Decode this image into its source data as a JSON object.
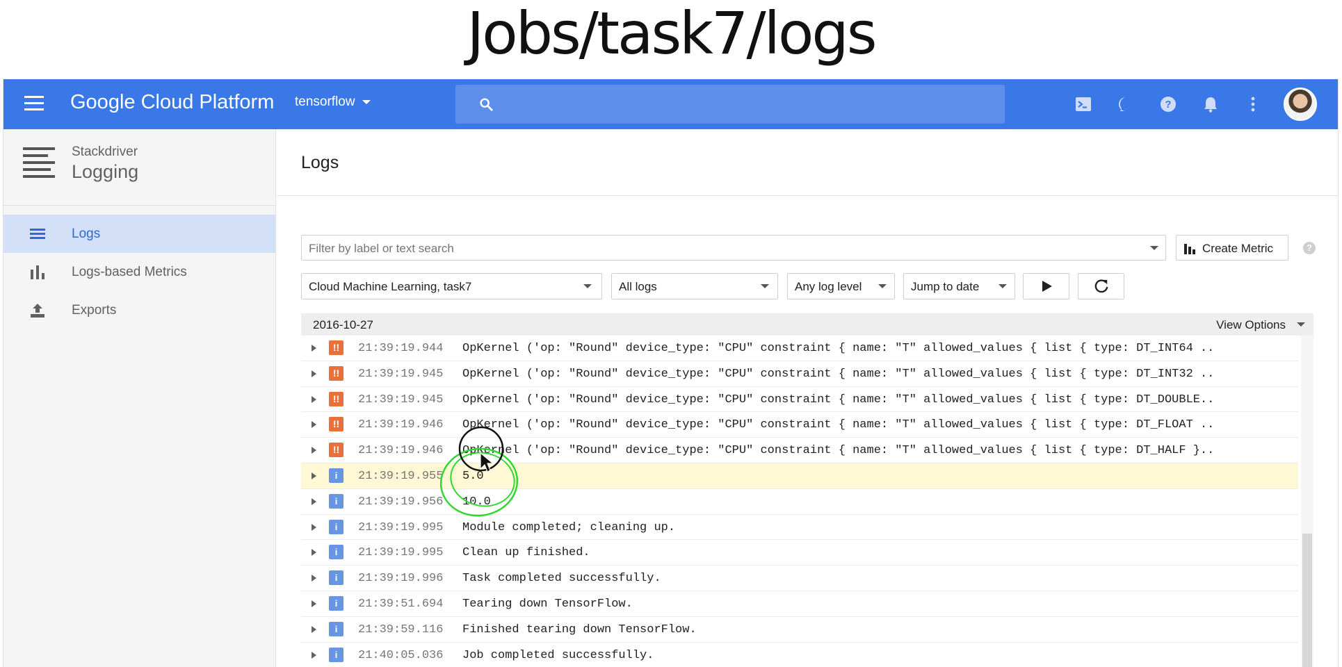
{
  "slide": {
    "title": "Jobs/task7/logs"
  },
  "topbar": {
    "brand": "Google Cloud Platform",
    "project": "tensorflow",
    "icons": [
      "cloud-shell-icon",
      "feedback-icon",
      "help-icon",
      "notifications-icon",
      "more-vert-icon",
      "avatar"
    ]
  },
  "sidebar": {
    "product_sub": "Stackdriver",
    "product_name": "Logging",
    "items": [
      {
        "label": "Logs",
        "icon": "logs-list-icon",
        "active": true
      },
      {
        "label": "Logs-based Metrics",
        "icon": "bar-chart-icon",
        "active": false
      },
      {
        "label": "Exports",
        "icon": "export-icon",
        "active": false
      }
    ]
  },
  "main": {
    "title": "Logs",
    "filter_placeholder": "Filter by label or text search",
    "create_metric": "Create Metric",
    "help": "?",
    "resource": "Cloud Machine Learning, task7",
    "log_name": "All logs",
    "log_level": "Any log level",
    "jump": "Jump to date",
    "date": "2016-10-27",
    "view_options": "View Options"
  },
  "logs": [
    {
      "severity": "error",
      "time": "21:39:19.944",
      "message": "OpKernel ('op: \"Round\" device_type: \"CPU\" constraint { name: \"T\" allowed_values { list { type: DT_INT64 .."
    },
    {
      "severity": "error",
      "time": "21:39:19.945",
      "message": "OpKernel ('op: \"Round\" device_type: \"CPU\" constraint { name: \"T\" allowed_values { list { type: DT_INT32 .."
    },
    {
      "severity": "error",
      "time": "21:39:19.945",
      "message": "OpKernel ('op: \"Round\" device_type: \"CPU\" constraint { name: \"T\" allowed_values { list { type: DT_DOUBLE.."
    },
    {
      "severity": "error",
      "time": "21:39:19.946",
      "message": "OpKernel ('op: \"Round\" device_type: \"CPU\" constraint { name: \"T\" allowed_values { list { type: DT_FLOAT .."
    },
    {
      "severity": "error",
      "time": "21:39:19.946",
      "message": "OpKernel ('op: \"Round\" device_type: \"CPU\" constraint { name: \"T\" allowed_values { list { type: DT_HALF }.."
    },
    {
      "severity": "info",
      "time": "21:39:19.955",
      "message": "5.0",
      "highlight": true
    },
    {
      "severity": "info",
      "time": "21:39:19.956",
      "message": "10.0"
    },
    {
      "severity": "info",
      "time": "21:39:19.995",
      "message": "Module completed; cleaning up."
    },
    {
      "severity": "info",
      "time": "21:39:19.995",
      "message": "Clean up finished."
    },
    {
      "severity": "info",
      "time": "21:39:19.996",
      "message": "Task completed successfully."
    },
    {
      "severity": "info",
      "time": "21:39:51.694",
      "message": "Tearing down TensorFlow."
    },
    {
      "severity": "info",
      "time": "21:39:59.116",
      "message": "Finished tearing down TensorFlow."
    },
    {
      "severity": "info",
      "time": "21:40:05.036",
      "message": "Job completed successfully."
    }
  ],
  "colors": {
    "topbar": "#3b78e7",
    "active_nav": "#d3e0f7",
    "error_badge": "#e8703a",
    "info_badge": "#6996e3",
    "highlight_row": "#fef9d4",
    "annotation_stroke": "#2fd72f"
  }
}
